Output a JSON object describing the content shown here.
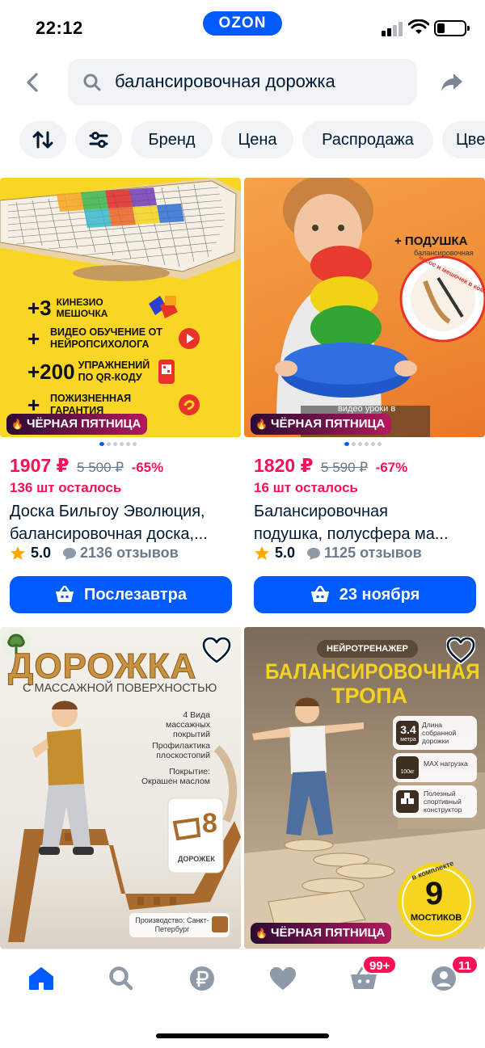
{
  "status_bar": {
    "time": "22:12",
    "brand_pill": "OZON"
  },
  "search": {
    "query": "балансировочная дорожка"
  },
  "filters": {
    "chips": [
      "Бренд",
      "Цена",
      "Распродажа",
      "Цве"
    ]
  },
  "products": [
    {
      "badge": "ЧЁРНАЯ ПЯТНИЦА",
      "price": "1907 ₽",
      "old_price": "5 500 ₽",
      "discount": "-65%",
      "stock": "136 шт осталось",
      "title_line1": "Доска Бильгоу Эволюция,",
      "title_line2": "балансировочная доска,...",
      "rating": "5.0",
      "reviews": "2136 отзывов",
      "delivery": "Послезавтра",
      "image": {
        "lines": [
          {
            "num": "+3",
            "text": "КИНЕЗИО МЕШОЧКА"
          },
          {
            "num": "+",
            "text": "ВИДЕО ОБУЧЕНИЕ ОТ НЕЙРОПСИХОЛОГА"
          },
          {
            "num": "+200",
            "text": "УПРАЖНЕНИЙ ПО QR-КОДУ"
          },
          {
            "num": "+",
            "text": "ПОЖИЗНЕННАЯ ГАРАНТИЯ"
          }
        ]
      }
    },
    {
      "badge": "ЧЁРНАЯ ПЯТНИЦА",
      "price": "1820 ₽",
      "old_price": "5 590 ₽",
      "discount": "-67%",
      "stock": "16 шт осталось",
      "title_line1": "Балансировочная",
      "title_line2": "подушка, полусфера ма...",
      "rating": "5.0",
      "reviews": "1125 отзывов",
      "delivery": "23 ноября",
      "image": {
        "headline": "+ ПОДУШКА",
        "sub": "балансировочная",
        "ring_text": "насос и мешочек в комплекте",
        "video": "видео уроки в"
      }
    },
    {
      "image": {
        "headline": "ДОРОЖКА",
        "sub": "С МАССАЖНОЙ ПОВЕРХНОСТЬЮ",
        "features": [
          "4 Вида массажных покрытий",
          "Профилактика плоскостопий",
          "Покрытие: Окрашен маслом"
        ],
        "count_num": "8",
        "count_label": "ДОРОЖЕК",
        "origin": "Производство: Санкт-Петербург"
      }
    },
    {
      "badge": "ЧЁРНАЯ ПЯТНИЦА",
      "image": {
        "pill": "НЕЙРОТРЕНАЖЕР",
        "headline1": "БАЛАНСИРОВОЧНАЯ",
        "headline2": "ТРОПА",
        "spec1_num": "3.4",
        "spec1_unit": "метра",
        "spec1_text": "Длина собранной дорожки",
        "spec2_num": "100кг",
        "spec2_text": "MAX нагрузка",
        "spec3_text": "Полезный спортивный конструктор",
        "bundle_top": "в комплекте",
        "bundle_num": "9",
        "bundle_label": "МОСТИКОВ"
      }
    }
  ],
  "bottom_nav": {
    "cart_badge": "99+",
    "profile_badge": "11"
  },
  "colors": {
    "accent": "#005bff",
    "sale": "#f91155",
    "text": "#001a34",
    "muted": "#6b7a8c"
  }
}
